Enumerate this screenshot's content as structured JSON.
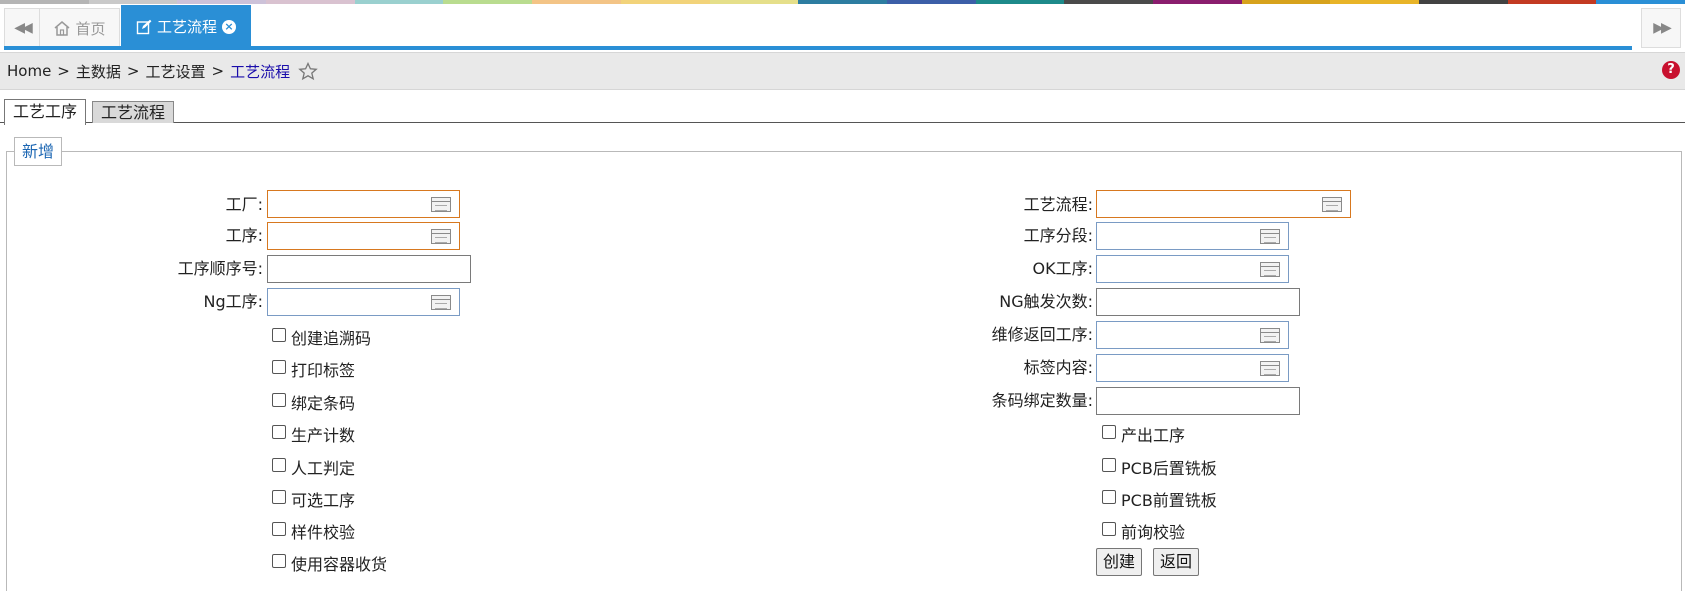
{
  "color_strip": [
    "#b5b5b5",
    "#c9c9c9",
    "#cdc2d9",
    "#d9c2d0",
    "#9ad0cf",
    "#b9dc8f",
    "#f3c486",
    "#f2d37a",
    "#e5df8a",
    "#2d7da1",
    "#3c5fa8",
    "#1d8a8a",
    "#4a4a4a",
    "#8a1d6e",
    "#d7a21c",
    "#e8b428",
    "#424242",
    "#c33a22",
    "#2a8fd6"
  ],
  "tabbar": {
    "home_label": "首页",
    "active_label": "工艺流程",
    "close_glyph": "×",
    "scroll_left_glyph": "◀◀",
    "scroll_right_glyph": "▶▶"
  },
  "breadcrumb": {
    "items": [
      "Home",
      "主数据",
      "工艺设置"
    ],
    "separator": ">",
    "current": "工艺流程",
    "help_glyph": "?"
  },
  "inner_tabs": [
    {
      "label": "工艺工序",
      "active": true
    },
    {
      "label": "工艺流程",
      "active": false
    }
  ],
  "panel": {
    "legend": "新增"
  },
  "form_left": {
    "factory_label": "工厂:",
    "process_label": "工序:",
    "sequence_label": "工序顺序号:",
    "ng_process_label": "Ng工序:"
  },
  "form_right": {
    "flow_label": "工艺流程:",
    "segment_label": "工序分段:",
    "ok_process_label": "OK工序:",
    "ng_count_label": "NG触发次数:",
    "repair_return_label": "维修返回工序:",
    "label_content_label": "标签内容:",
    "barcode_bind_qty_label": "条码绑定数量:"
  },
  "checks_left": [
    "创建追溯码",
    "打印标签",
    "绑定条码",
    "生产计数",
    "人工判定",
    "可选工序",
    "样件校验",
    "使用容器收货"
  ],
  "checks_right": [
    "产出工序",
    "PCB后置铣板",
    "PCB前置铣板",
    "前询校验"
  ],
  "buttons": {
    "create": "创建",
    "back": "返回"
  }
}
